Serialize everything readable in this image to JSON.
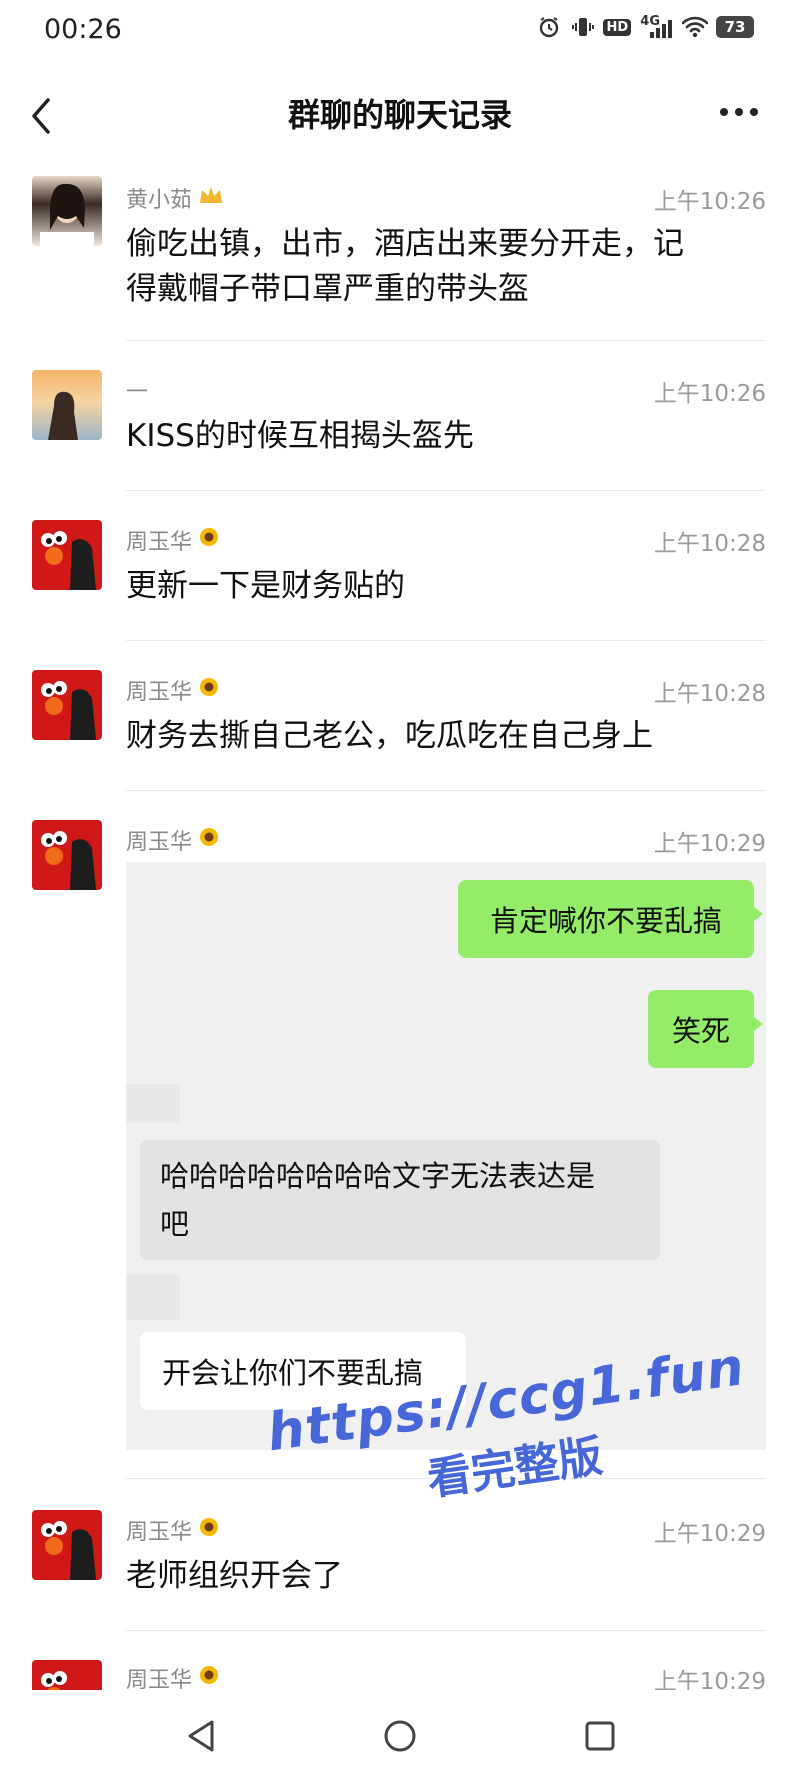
{
  "status_bar": {
    "time": "00:26",
    "icons": [
      "alarm-icon",
      "vibrate-icon",
      "hd-icon",
      "4g-signal-icon",
      "wifi-icon",
      "battery-icon"
    ],
    "hd": "HD",
    "network": "4G",
    "battery": "73"
  },
  "header": {
    "title": "群聊的聊天记录"
  },
  "messages": [
    {
      "name": "黄小茹",
      "badge": "crown-icon",
      "time": "上午10:26",
      "lines": [
        "偷吃出镇，出市，酒店出来要分开走，记",
        "得戴帽子带口罩严重的带头盔"
      ]
    },
    {
      "name": "一",
      "time": "上午10:26",
      "lines": [
        "KISS的时候互相揭头盔先"
      ]
    },
    {
      "name": "周玉华",
      "badge": "sunflower-icon",
      "time": "上午10:28",
      "lines": [
        "更新一下是财务贴的"
      ]
    },
    {
      "name": "周玉华",
      "badge": "sunflower-icon",
      "time": "上午10:28",
      "lines": [
        "财务去撕自己老公，吃瓜吃在自己身上"
      ]
    },
    {
      "name": "周玉华",
      "badge": "sunflower-icon",
      "time": "上午10:29"
    },
    {
      "name": "周玉华",
      "badge": "sunflower-icon",
      "time": "上午10:29",
      "lines": [
        "老师组织开会了"
      ]
    },
    {
      "name": "周玉华",
      "badge": "sunflower-icon",
      "time": "上午10:29"
    }
  ],
  "screenshot_card": {
    "green1": "肯定喊你不要乱搞",
    "green2": "笑死",
    "gray_lines": [
      "哈哈哈哈哈哈哈哈文字无法表达是",
      "吧"
    ],
    "white": "开会让你们不要乱搞"
  },
  "watermark": {
    "line1": "https://ccg1.fun",
    "line2": "看完整版",
    "color": "#4766d8"
  },
  "colors": {
    "bubble_green": "#95ec69",
    "timestamp": "#9a9a9a"
  }
}
